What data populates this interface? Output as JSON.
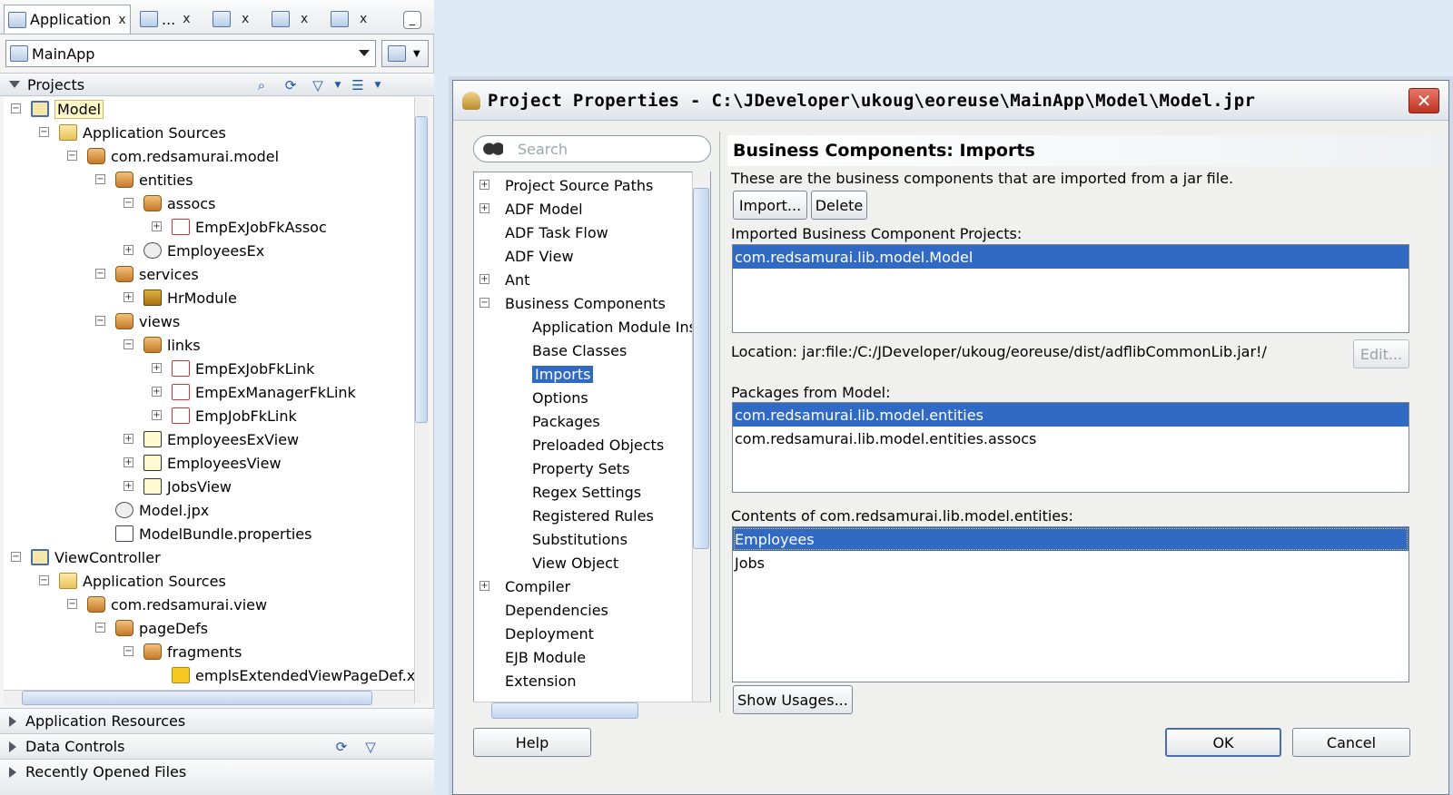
{
  "left_panel": {
    "tabs": [
      {
        "label": "Application",
        "close": "x"
      },
      {
        "label": "...",
        "close": "x"
      },
      {
        "label": "",
        "close": "x"
      },
      {
        "label": "",
        "close": "x"
      },
      {
        "label": "",
        "close": "x"
      }
    ],
    "app_selector": {
      "value": "MainApp"
    },
    "projects_header": "Projects",
    "tree": [
      {
        "label": "Model",
        "icon": "project-icon",
        "selected": true
      },
      {
        "label": "Application Sources",
        "icon": "folder-icon"
      },
      {
        "label": "com.redsamurai.model",
        "icon": "package-icon"
      },
      {
        "label": "entities",
        "icon": "package-icon"
      },
      {
        "label": "assocs",
        "icon": "package-icon"
      },
      {
        "label": "EmpExJobFkAssoc",
        "icon": "association-icon"
      },
      {
        "label": "EmployeesEx",
        "icon": "entity-object-icon"
      },
      {
        "label": "services",
        "icon": "package-icon"
      },
      {
        "label": "HrModule",
        "icon": "application-module-icon"
      },
      {
        "label": "views",
        "icon": "package-icon"
      },
      {
        "label": "links",
        "icon": "package-icon"
      },
      {
        "label": "EmpExJobFkLink",
        "icon": "view-link-icon"
      },
      {
        "label": "EmpExManagerFkLink",
        "icon": "view-link-icon"
      },
      {
        "label": "EmpJobFkLink",
        "icon": "view-link-icon"
      },
      {
        "label": "EmployeesExView",
        "icon": "view-object-icon"
      },
      {
        "label": "EmployeesView",
        "icon": "view-object-icon"
      },
      {
        "label": "JobsView",
        "icon": "view-object-icon"
      },
      {
        "label": "Model.jpx",
        "icon": "gear-file-icon"
      },
      {
        "label": "ModelBundle.properties",
        "icon": "properties-file-icon"
      },
      {
        "label": "ViewController",
        "icon": "project-icon"
      },
      {
        "label": "Application Sources",
        "icon": "folder-icon"
      },
      {
        "label": "com.redsamurai.view",
        "icon": "package-icon"
      },
      {
        "label": "pageDefs",
        "icon": "package-icon"
      },
      {
        "label": "fragments",
        "icon": "package-icon"
      },
      {
        "label": "emplsExtendedViewPageDef.x",
        "icon": "page-def-icon"
      }
    ],
    "accordion": [
      "Application Resources",
      "Data Controls",
      "Recently Opened Files"
    ]
  },
  "dialog": {
    "title": "Project Properties - C:\\JDeveloper\\ukoug\\eoreuse\\MainApp\\Model\\Model.jpr",
    "close": "✕",
    "search_placeholder": "Search",
    "nav": [
      {
        "label": "Project Source Paths"
      },
      {
        "label": "ADF Model"
      },
      {
        "label": "ADF Task Flow"
      },
      {
        "label": "ADF View"
      },
      {
        "label": "Ant"
      },
      {
        "label": "Business Components"
      },
      {
        "label": "Application Module Inst"
      },
      {
        "label": "Base Classes"
      },
      {
        "label": "Imports"
      },
      {
        "label": "Options"
      },
      {
        "label": "Packages"
      },
      {
        "label": "Preloaded Objects"
      },
      {
        "label": "Property Sets"
      },
      {
        "label": "Regex Settings"
      },
      {
        "label": "Registered Rules"
      },
      {
        "label": "Substitutions"
      },
      {
        "label": "View Object"
      },
      {
        "label": "Compiler"
      },
      {
        "label": "Dependencies"
      },
      {
        "label": "Deployment"
      },
      {
        "label": "EJB Module"
      },
      {
        "label": "Extension"
      }
    ],
    "section_title": "Business Components: Imports",
    "description": "These are the business components that are imported from a jar file.",
    "import_button": "Import...",
    "delete_button": "Delete",
    "imported_label": "Imported Business Component Projects:",
    "imported_items": [
      "com.redsamurai.lib.model.Model"
    ],
    "location_label": "Location: jar:file:/C:/JDeveloper/ukoug/eoreuse/dist/adflibCommonLib.jar!/",
    "edit_button": "Edit...",
    "packages_label": "Packages from Model:",
    "packages_items": [
      "com.redsamurai.lib.model.entities",
      "com.redsamurai.lib.model.entities.assocs"
    ],
    "contents_label": "Contents of com.redsamurai.lib.model.entities:",
    "contents_items": [
      "Employees",
      "Jobs"
    ],
    "show_usages_button": "Show Usages...",
    "help_button": "Help",
    "ok_button": "OK",
    "cancel_button": "Cancel"
  }
}
